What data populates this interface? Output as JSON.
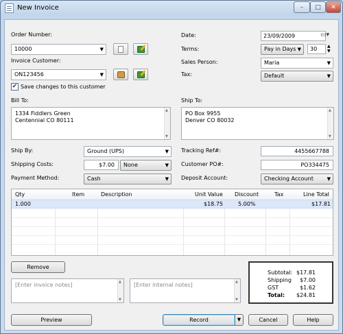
{
  "window": {
    "title": "New Invoice",
    "controls": {
      "minimize": "–",
      "maximize": "□",
      "close": "✕"
    }
  },
  "order": {
    "order_number_label": "Order Number:",
    "order_number_value": "10000",
    "invoice_customer_label": "Invoice Customer:",
    "invoice_customer_value": "ON123456",
    "save_changes_label": "Save changes to this customer",
    "save_changes_checked": true
  },
  "meta": {
    "date_label": "Date:",
    "date_value": "23/09/2009",
    "terms_label": "Terms:",
    "terms_value": "Pay in Days",
    "terms_days": "30",
    "sales_person_label": "Sales Person:",
    "sales_person_value": "Maria",
    "tax_label": "Tax:",
    "tax_value": "Default"
  },
  "addresses": {
    "bill_to_label": "Bill To:",
    "bill_to_lines": [
      "1334 Fiddlers Green",
      "Centennial CO 80111"
    ],
    "ship_to_label": "Ship To:",
    "ship_to_lines": [
      "PO Box 9955",
      "Denver CO 80032"
    ]
  },
  "shipping": {
    "ship_by_label": "Ship By:",
    "ship_by_value": "Ground (UPS)",
    "shipping_costs_label": "Shipping Costs:",
    "shipping_costs_value": "$7.00",
    "shipping_tax_value": "None",
    "payment_method_label": "Payment Method:",
    "payment_method_value": "Cash",
    "tracking_label": "Tracking Ref#:",
    "tracking_value": "4455667788",
    "customer_po_label": "Customer PO#:",
    "customer_po_value": "PO334475",
    "deposit_account_label": "Deposit Account:",
    "deposit_account_value": "Checking Account"
  },
  "lines": {
    "columns": [
      "Qty",
      "Item",
      "Description",
      "Unit Value",
      "Discount",
      "Tax",
      "Line Total"
    ],
    "rows": [
      {
        "qty": "1.000",
        "item": "",
        "description": "",
        "unit_value": "$18.75",
        "discount": "5.00%",
        "tax": "",
        "line_total": "$17.81"
      }
    ]
  },
  "notes": {
    "remove_label": "Remove",
    "invoice_notes_placeholder": "[Enter invoice notes]",
    "internal_notes_placeholder": "[Enter internal notes]"
  },
  "totals": {
    "subtotal_label": "Subtotal:",
    "subtotal_value": "$17.81",
    "shipping_label": "Shipping",
    "shipping_value": "$7.00",
    "gst_label": "GST",
    "gst_value": "$1.62",
    "total_label": "Total:",
    "total_value": "$24.81"
  },
  "footer": {
    "preview_label": "Preview",
    "record_label": "Record",
    "cancel_label": "Cancel",
    "help_label": "Help"
  }
}
